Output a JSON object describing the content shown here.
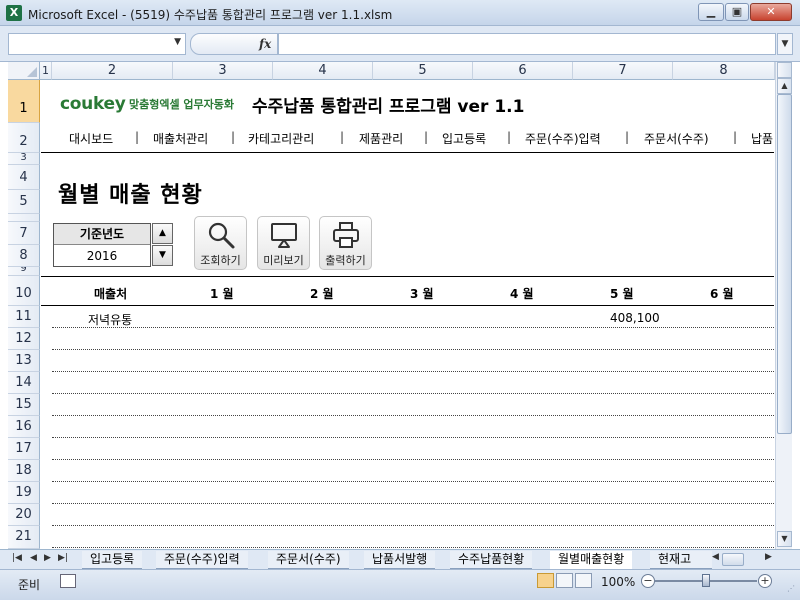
{
  "window": {
    "app_icon": "X",
    "title": "Microsoft Excel - (5519) 수주납품 통합관리 프로그램 ver 1.1.xlsm",
    "btn_minimize": "▁",
    "btn_restore": "▣",
    "btn_close": "✕"
  },
  "formula_bar": {
    "name_box": "",
    "fx": "fx",
    "formula": ""
  },
  "columns": [
    "1",
    "2",
    "3",
    "4",
    "5",
    "6",
    "7",
    "8"
  ],
  "rows": [
    "1",
    "2",
    "3",
    "4",
    "5",
    "7",
    "8",
    "9",
    "10",
    "11",
    "12",
    "13",
    "14",
    "15",
    "16",
    "17",
    "18",
    "19",
    "20",
    "21"
  ],
  "header": {
    "logo": "coukey",
    "logo_sub": "맞춤형엑셀 업무자동화",
    "title": "수주납품 통합관리 프로그램 ver 1.1"
  },
  "nav": {
    "items": [
      "대시보드",
      "매출처관리",
      "카테고리관리",
      "제품관리",
      "입고등록",
      "주문(수주)입력",
      "주문서(수주)",
      "납품"
    ],
    "separator": "|"
  },
  "page_title": "월별 매출 현황",
  "year_selector": {
    "label": "기준년도",
    "value": "2016",
    "up": "▲",
    "down": "▼"
  },
  "buttons": {
    "search": "조회하기",
    "preview": "미리보기",
    "print": "출력하기"
  },
  "table": {
    "headers": [
      "매출처",
      "1 월",
      "2 월",
      "3 월",
      "4 월",
      "5 월",
      "6 월"
    ],
    "rows": [
      {
        "customer": "저녁유통",
        "m5": "408,100"
      }
    ]
  },
  "sheet_tabs": [
    "입고등록",
    "주문(수주)입력",
    "주문서(수주)",
    "납품서발행",
    "수주납품현황",
    "월별매출현황",
    "현재고"
  ],
  "active_tab": "월별매출현황",
  "status": {
    "ready": "준비",
    "zoom": "100%",
    "zoom_minus": "−",
    "zoom_plus": "+"
  },
  "tab_nav": [
    "|◀",
    "◀",
    "▶",
    "▶|"
  ],
  "colors": {
    "logo_green": "#2a7a35",
    "selected_row_header": "#f9d99f",
    "excel_green": "#1e7145"
  }
}
